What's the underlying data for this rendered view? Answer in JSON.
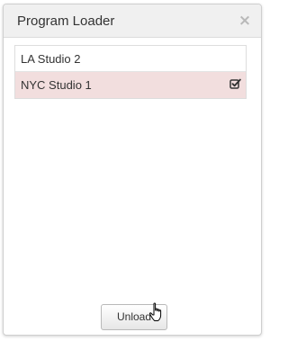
{
  "dialog": {
    "title": "Program Loader",
    "close_glyph": "×"
  },
  "program_list": [
    {
      "label": "LA Studio 2",
      "selected": false
    },
    {
      "label": "NYC Studio 1",
      "selected": true,
      "icon": "checked-box-icon"
    }
  ],
  "footer": {
    "unload_label": "Unload"
  },
  "colors": {
    "selected_row": "#f2dede",
    "titlebar": "#f0f0f0"
  },
  "pointer": {
    "icon": "hand-pointer-icon"
  }
}
